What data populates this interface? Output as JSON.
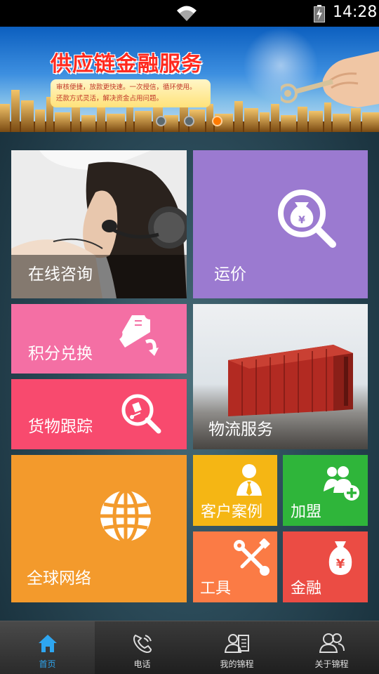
{
  "status_bar": {
    "time": "14:28"
  },
  "banner": {
    "title": "供应链金融服务",
    "desc_line1": "审核便捷，放款更快速。一次授信，循环使用。",
    "desc_line2": "还款方式灵活，解决资金占用问题。",
    "slide_count": 3,
    "active_slide": 3
  },
  "tiles": {
    "consult": "在线咨询",
    "freight": "运价",
    "points": "积分兑换",
    "track": "货物跟踪",
    "logistics": "物流服务",
    "global": "全球网络",
    "cases": "客户案例",
    "join": "加盟",
    "tools": "工具",
    "finance": "金融"
  },
  "nav": {
    "home": "首页",
    "phone": "电话",
    "mine": "我的锦程",
    "about": "关于锦程"
  },
  "colors": {
    "freight": "#9b7ad0",
    "points": "#f46fa4",
    "track": "#f84a6e",
    "global": "#f39a2c",
    "cases": "#f5b614",
    "join": "#2fb53a",
    "tools": "#fb7b45",
    "finance": "#eb4c44",
    "nav_active": "#2ea6f0"
  }
}
